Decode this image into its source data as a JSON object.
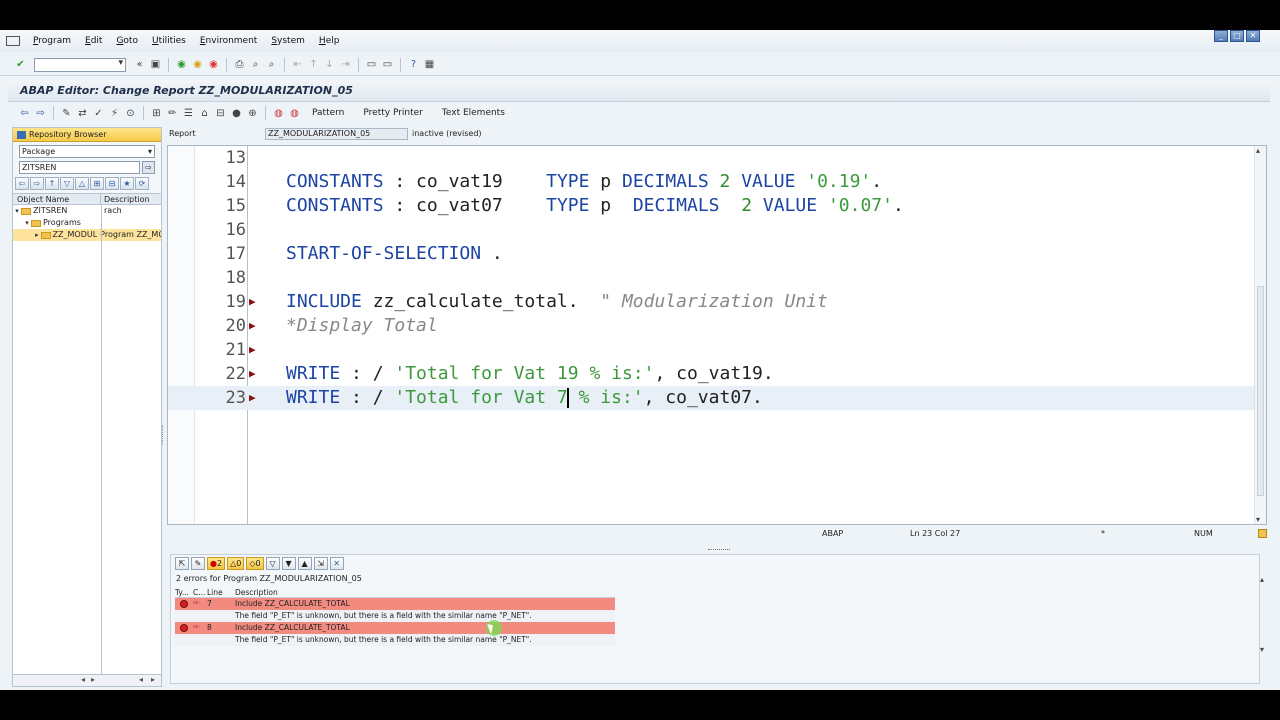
{
  "menu": [
    "Program",
    "Edit",
    "Goto",
    "Utilities",
    "Environment",
    "System",
    "Help"
  ],
  "window_controls": [
    "_",
    "□",
    "✕"
  ],
  "title": "ABAP Editor: Change Report ZZ_MODULARIZATION_05",
  "app_toolbar": {
    "pattern": "Pattern",
    "pretty_printer": "Pretty Printer",
    "text_elements": "Text Elements"
  },
  "repo": {
    "header": "Repository Browser",
    "object_type": "Package",
    "object_name": "ZITSREN",
    "col_name": "Object Name",
    "col_desc": "Description",
    "tree": [
      {
        "name": "ZITSREN",
        "desc": "rach"
      },
      {
        "name": "Programs",
        "desc": ""
      },
      {
        "name": "ZZ_MODUL",
        "desc": "Program ZZ_MO"
      }
    ]
  },
  "report": {
    "label": "Report",
    "name": "ZZ_MODULARIZATION_05",
    "status": "inactive (revised)"
  },
  "editor": {
    "lines": [
      {
        "num": "13",
        "marker": false,
        "cur": false,
        "parts": []
      },
      {
        "num": "14",
        "marker": false,
        "cur": false,
        "parts": [
          [
            "kw",
            "CONSTANTS"
          ],
          [
            "id",
            " : co_vat19    "
          ],
          [
            "kw",
            "TYPE"
          ],
          [
            "id",
            " p "
          ],
          [
            "kw",
            "DECIMALS"
          ],
          [
            "id",
            " "
          ],
          [
            "num",
            "2"
          ],
          [
            "id",
            " "
          ],
          [
            "kw",
            "VALUE"
          ],
          [
            "id",
            " "
          ],
          [
            "str",
            "'0.19'"
          ],
          [
            "id",
            "."
          ]
        ]
      },
      {
        "num": "15",
        "marker": false,
        "cur": false,
        "parts": [
          [
            "kw",
            "CONSTANTS"
          ],
          [
            "id",
            " : co_vat07    "
          ],
          [
            "kw",
            "TYPE"
          ],
          [
            "id",
            " p  "
          ],
          [
            "kw",
            "DECIMALS"
          ],
          [
            "id",
            "  "
          ],
          [
            "num",
            "2"
          ],
          [
            "id",
            " "
          ],
          [
            "kw",
            "VALUE"
          ],
          [
            "id",
            " "
          ],
          [
            "str",
            "'0.07'"
          ],
          [
            "id",
            "."
          ]
        ]
      },
      {
        "num": "16",
        "marker": false,
        "cur": false,
        "parts": []
      },
      {
        "num": "17",
        "marker": false,
        "cur": false,
        "parts": [
          [
            "kw",
            "START-OF-SELECTION"
          ],
          [
            "id",
            " ."
          ]
        ]
      },
      {
        "num": "18",
        "marker": false,
        "cur": false,
        "parts": []
      },
      {
        "num": "19",
        "marker": true,
        "cur": false,
        "parts": [
          [
            "kw",
            "INCLUDE"
          ],
          [
            "id",
            " zz_calculate_total.  "
          ],
          [
            "cmt",
            "\" Modularization Unit"
          ]
        ]
      },
      {
        "num": "20",
        "marker": true,
        "cur": false,
        "parts": [
          [
            "cmt",
            "*Display Total"
          ]
        ]
      },
      {
        "num": "21",
        "marker": true,
        "cur": false,
        "parts": []
      },
      {
        "num": "22",
        "marker": true,
        "cur": false,
        "parts": [
          [
            "kw",
            "WRITE"
          ],
          [
            "id",
            " : / "
          ],
          [
            "str",
            "'Total for Vat 19 % is:'"
          ],
          [
            "id",
            ", co_vat19."
          ]
        ]
      },
      {
        "num": "23",
        "marker": true,
        "cur": true,
        "parts": [
          [
            "kw",
            "WRITE"
          ],
          [
            "id",
            " : / "
          ],
          [
            "str",
            "'Total for Vat 7"
          ],
          [
            "caret",
            ""
          ],
          [
            "str",
            " % is:'"
          ],
          [
            "id",
            ", co_vat07."
          ]
        ]
      }
    ]
  },
  "status": {
    "lang": "ABAP",
    "pos": "Ln  23 Col  27",
    "mod": "*",
    "num": "NUM"
  },
  "errors": {
    "toolbar": {
      "err_count": "2",
      "warn_count": "0",
      "info_count": "0"
    },
    "summary": "2 errors for Program ZZ_MODULARIZATION_05",
    "columns": {
      "type": "Ty...",
      "c": "C...",
      "line": "Line",
      "desc": "Description"
    },
    "rows": [
      {
        "line": "7",
        "include": "Include ZZ_CALCULATE_TOTAL",
        "message": "The field \"P_ET\" is unknown, but there is a field with the similar name \"P_NET\"."
      },
      {
        "line": "8",
        "include": "Include ZZ_CALCULATE_TOTAL",
        "message": "The field \"P_ET\" is unknown, but there is a field with the similar name \"P_NET\"."
      }
    ]
  }
}
